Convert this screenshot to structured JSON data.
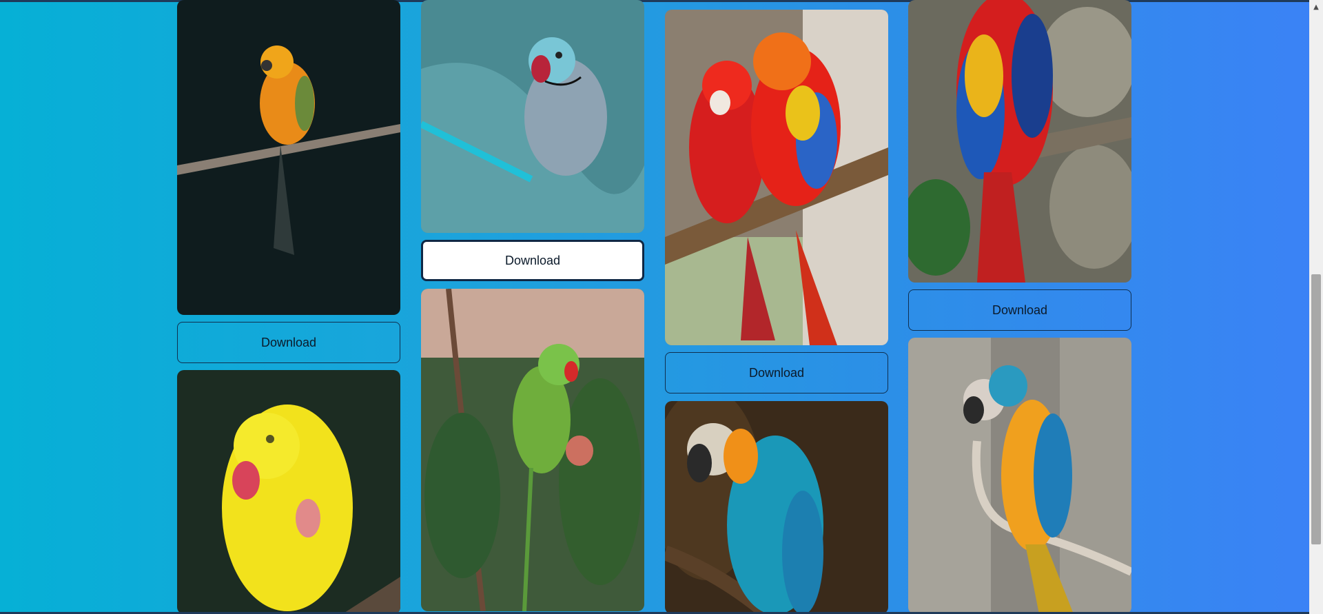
{
  "gallery": {
    "download_label": "Download",
    "cards": [
      {
        "image": "sun-conure-on-branch",
        "button": "Download"
      },
      {
        "image": "yellow-parakeet",
        "button": null
      },
      {
        "image": "blue-ringneck-on-fabric",
        "button": "Download"
      },
      {
        "image": "green-parakeet-in-tree",
        "button": null
      },
      {
        "image": "two-scarlet-macaws",
        "button": "Download"
      },
      {
        "image": "blue-gold-macaw-dark",
        "button": null
      },
      {
        "image": "scarlet-macaw-on-rock",
        "button": "Download"
      },
      {
        "image": "blue-gold-macaw-stone",
        "button": null
      }
    ]
  },
  "colors": {
    "bg_left": "#06b0d6",
    "bg_right": "#3b82f6",
    "button_border": "#0f2f4f",
    "focused_button_bg": "#ffffff"
  },
  "scrollbar": {
    "up_icon": "chevron-up-icon"
  }
}
